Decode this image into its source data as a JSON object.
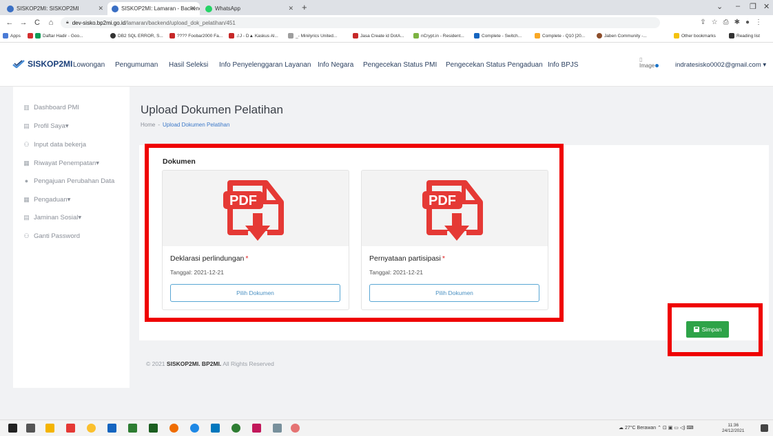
{
  "browser": {
    "tabs": [
      {
        "label": "SISKOP2MI: SISKOP2MI",
        "active": false
      },
      {
        "label": "SISKOP2MI: Lamaran - Backend",
        "active": true
      },
      {
        "label": "WhatsApp",
        "active": false
      }
    ],
    "url_host": "dev-sisko.bp2mi.go.id",
    "url_path": "/lamaran/backend/upload_dok_pelatihan/451",
    "bookmarks": [
      "Apps",
      "Daftar Hadir - Goo...",
      "DB2 SQL ERROR, S...",
      "???? Foobar2000 Fa...",
      "♫J - D▲ Kaskus Al...",
      "_- Minilyrics United...",
      "Jasa Create id DotA...",
      "nCrypt.in - Resident...",
      "Complete - Switch...",
      "Complete - Q10 [20...",
      "Jaben Community -...",
      "Other bookmarks",
      "Reading list"
    ]
  },
  "header": {
    "logo_text": "SISKOP2MI",
    "nav": [
      "Lowongan",
      "Pengumuman",
      "Hasil Seleksi",
      "Info Penyelenggaran Layanan",
      "Info Negara",
      "Pengecekan Status PMI",
      "Pengecekan Status Pengaduan",
      "Info BPJS"
    ],
    "avatar_alt": "Image",
    "user_email": "indratesisko0002@gmail.com ▾"
  },
  "sidebar": {
    "items": [
      {
        "label": "Dashboard PMI",
        "icon": "dashboard-icon"
      },
      {
        "label": "Profil Saya▾",
        "icon": "profile-icon"
      },
      {
        "label": "Input data bekerja",
        "icon": "user-icon"
      },
      {
        "label": "Riwayat Penempatan▾",
        "icon": "history-icon"
      },
      {
        "label": "Pengajuan Perubahan Data",
        "icon": "info-icon"
      },
      {
        "label": "Pengaduan▾",
        "icon": "complaint-icon"
      },
      {
        "label": "Jaminan Sosial▾",
        "icon": "insurance-icon"
      },
      {
        "label": "Ganti Password",
        "icon": "lock-icon"
      }
    ]
  },
  "main": {
    "title": "Upload Dokumen Pelatihan",
    "breadcrumb": {
      "home": "Home",
      "sep": "-",
      "current": "Upload Dokumen Pelatihan"
    },
    "section_label": "Dokumen",
    "documents": [
      {
        "name": "Deklarasi perlindungan",
        "required": "*",
        "date": "Tanggal: 2021-12-21",
        "button": "Pilih Dokumen",
        "thumb_label": "PDF"
      },
      {
        "name": "Pernyataan partisipasi",
        "required": "*",
        "date": "Tanggal: 2021-12-21",
        "button": "Pilih Dokumen",
        "thumb_label": "PDF"
      }
    ],
    "save_label": "Simpan"
  },
  "footer": {
    "prefix": "© 2021",
    "brand": "SISKOP2MI. BP2MI.",
    "suffix": "All Rights Reserved"
  },
  "taskbar": {
    "weather": "27°C Berawan",
    "time": "11:36",
    "date": "24/12/2021"
  },
  "colors": {
    "accent": "#2ea348",
    "highlight": "#ef0000",
    "pdf_red": "#e53935",
    "link": "#3b78c8"
  }
}
